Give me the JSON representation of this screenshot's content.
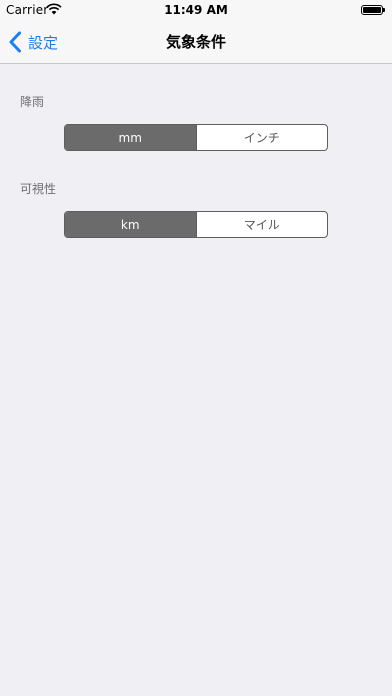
{
  "status_bar": {
    "carrier": "Carrier",
    "time": "11:49 AM"
  },
  "nav": {
    "back_label": "設定",
    "title": "気象条件"
  },
  "sections": {
    "rain": {
      "label": "降雨",
      "options": [
        "mm",
        "インチ"
      ],
      "selected": "mm"
    },
    "visibility": {
      "label": "可視性",
      "options": [
        "km",
        "マイル"
      ],
      "selected": "km"
    }
  },
  "colors": {
    "background": "#efeff4",
    "tint": "#1a7ef5",
    "segment_selected": "#6b6b6b"
  },
  "icons": {
    "wifi": "wifi-icon",
    "battery": "battery-icon",
    "back": "chevron-left-icon"
  }
}
